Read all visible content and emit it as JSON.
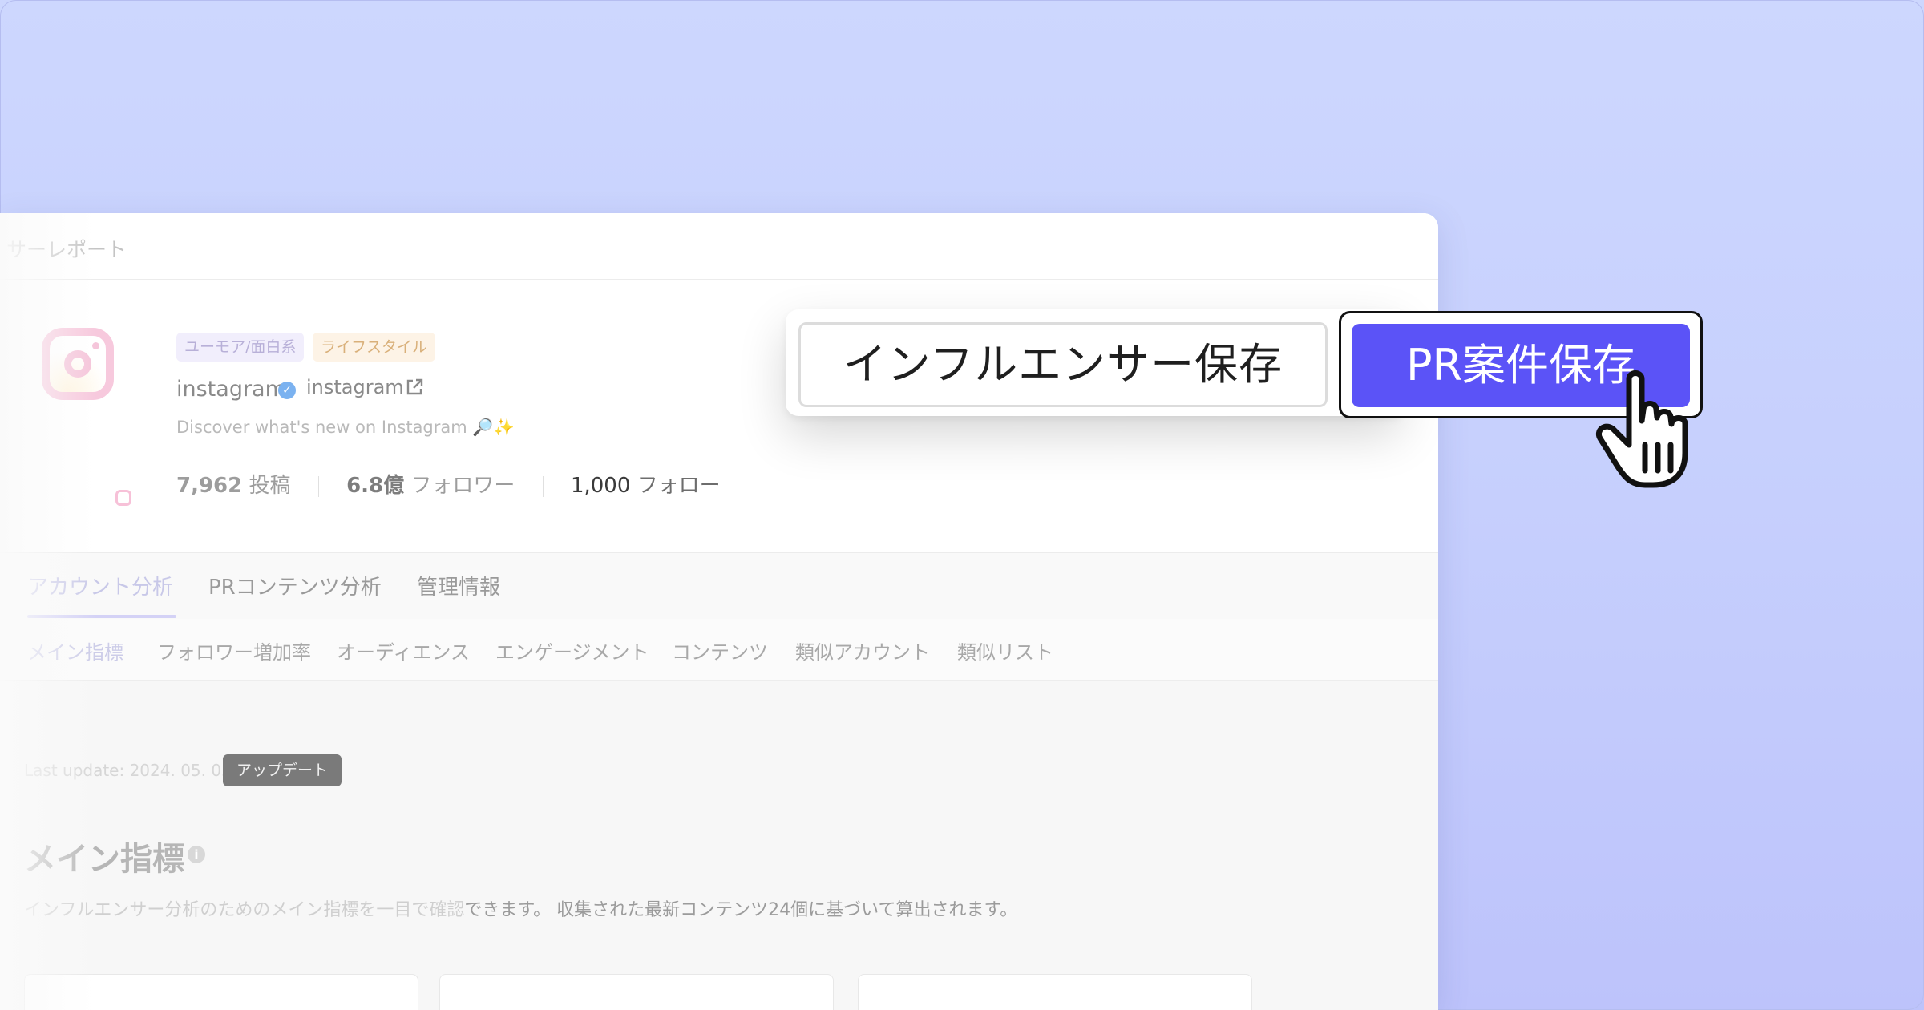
{
  "header": {
    "breadcrumb": "サーレポート"
  },
  "profile": {
    "tags": [
      "ユーモア/面白系",
      "ライフスタイル"
    ],
    "name": "instagram",
    "handle": "instagram",
    "bio": "Discover what's new on Instagram 🔎✨",
    "stats": [
      {
        "value": "7,962",
        "label": "投稿"
      },
      {
        "value": "6.8億",
        "label": "フォロワー"
      },
      {
        "value": "1,000",
        "label": "フォロー"
      }
    ]
  },
  "tabs": [
    "アカウント分析",
    "PRコンテンツ分析",
    "管理情報"
  ],
  "subtabs": [
    "メイン指標",
    "フォロワー増加率",
    "オーディエンス",
    "エンゲージメント",
    "コンテンツ",
    "類似アカウント",
    "類似リスト"
  ],
  "content": {
    "last_update": "Last update: 2024. 05. 05",
    "update_button": "アップデート",
    "section_title": "メイン指標",
    "description_dim": "インフルエンサー分析のためのメイン指標を一目で確認",
    "description_rest": "できます。 収集された最新コンテンツ24個に基づいて算出されます。"
  },
  "save_bar": {
    "influencer_button": "インフルエンサー保存",
    "pr_button": "PR案件保存"
  },
  "colors": {
    "background": "#c9d2fe",
    "accent": "#5b53f7"
  },
  "icons": [
    "external-link-icon",
    "verified-icon",
    "info-icon",
    "hand-cursor-icon",
    "instagram-logo"
  ]
}
